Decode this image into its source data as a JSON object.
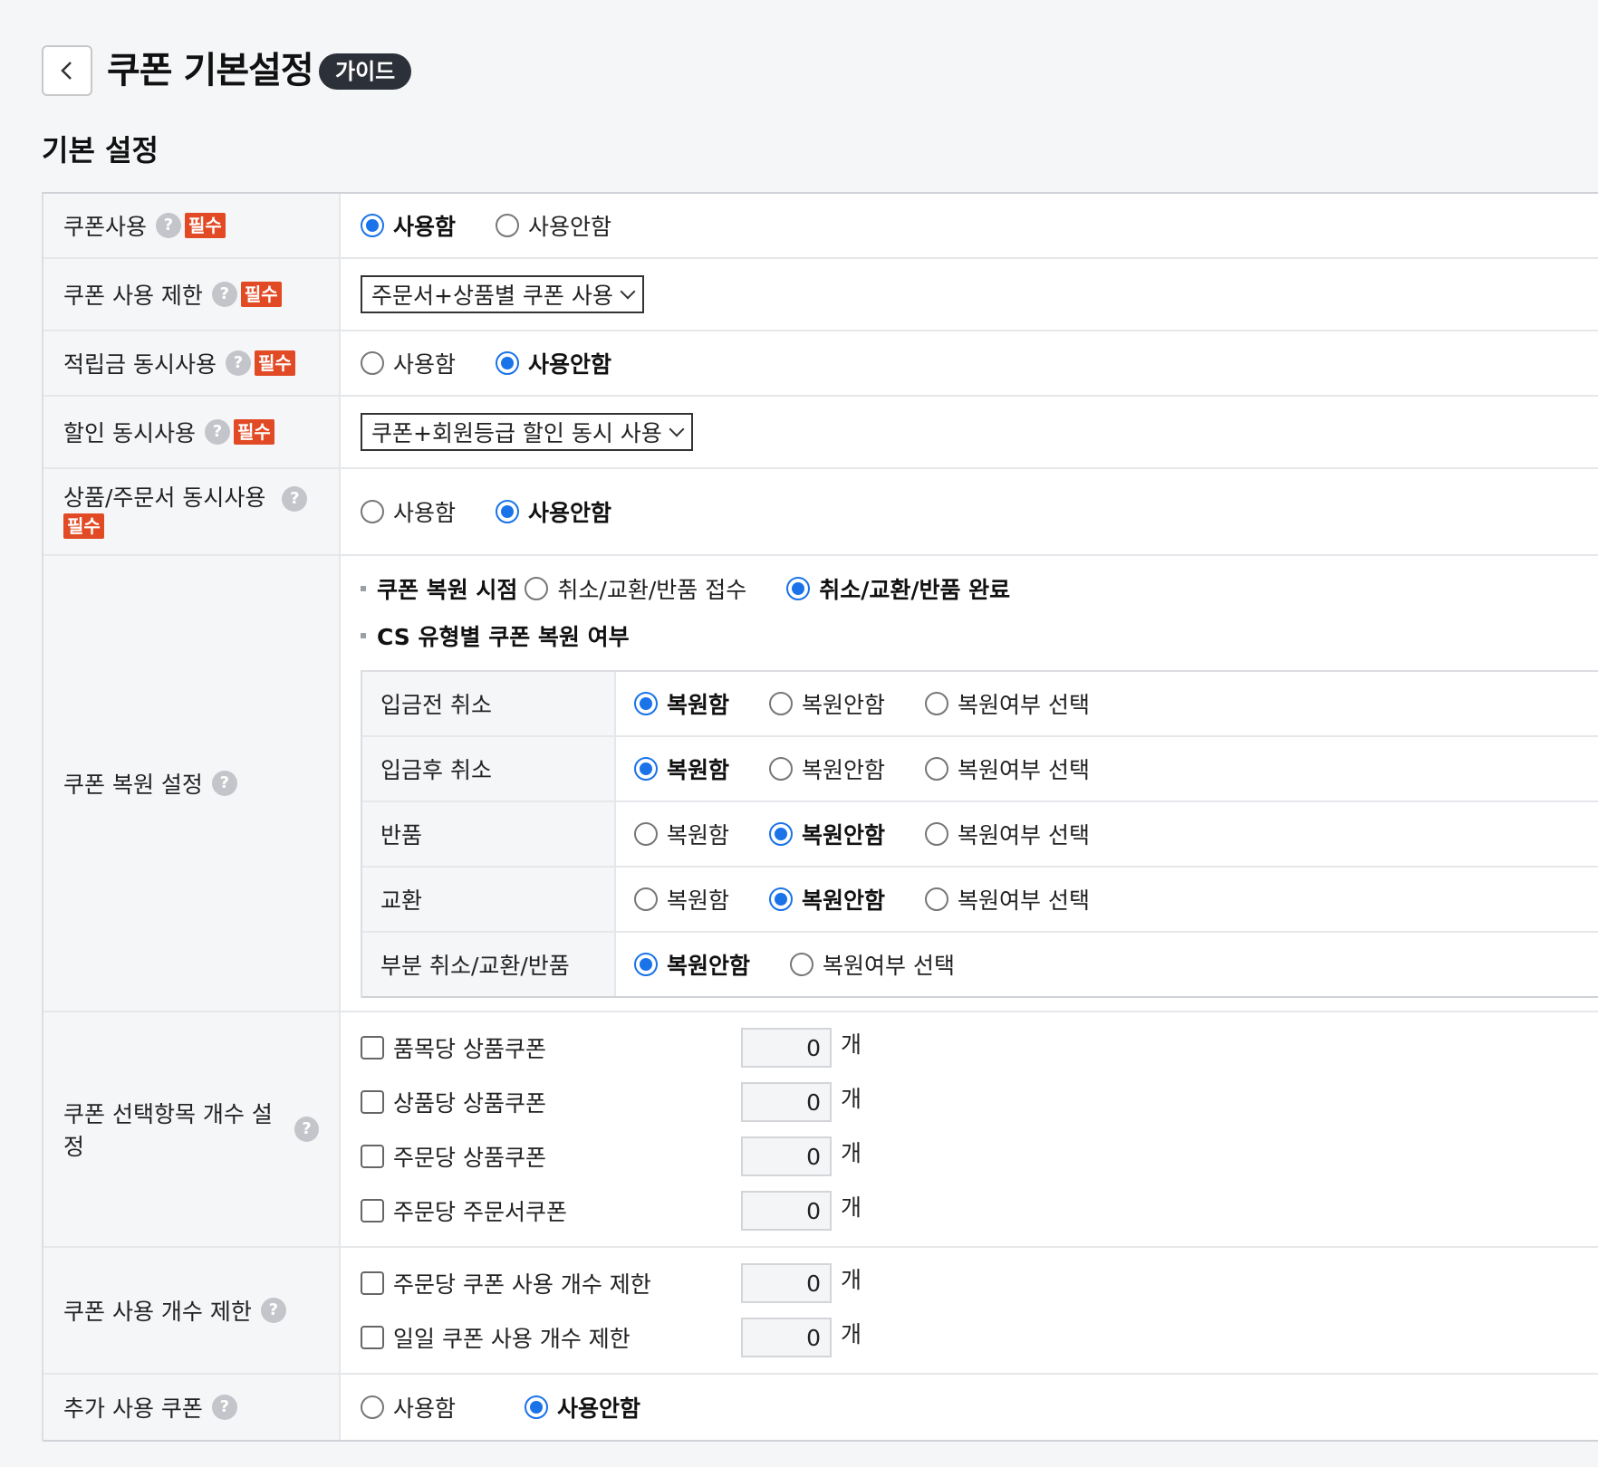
{
  "header": {
    "title": "쿠폰 기본설정",
    "guide_label": "가이드"
  },
  "section_title": "기본 설정",
  "badges": {
    "help": "?",
    "required": "필수"
  },
  "rows": {
    "coupon_use": {
      "label": "쿠폰사용",
      "options": [
        "사용함",
        "사용안함"
      ],
      "selected": 0
    },
    "coupon_limit": {
      "label": "쿠폰 사용 제한",
      "select_value": "주문서+상품별 쿠폰 사용"
    },
    "points_concurrent": {
      "label": "적립금 동시사용",
      "options": [
        "사용함",
        "사용안함"
      ],
      "selected": 1
    },
    "discount_concurrent": {
      "label": "할인 동시사용",
      "select_value": "쿠폰+회원등급 할인 동시 사용"
    },
    "product_order_concurrent": {
      "label": "상품/주문서 동시사용",
      "options": [
        "사용함",
        "사용안함"
      ],
      "selected": 1
    },
    "restore": {
      "label": "쿠폰 복원 설정",
      "timing_label": "쿠폰 복원 시점",
      "timing_options": [
        "취소/교환/반품 접수",
        "취소/교환/반품 완료"
      ],
      "timing_selected": 1,
      "cs_label": "CS 유형별 쿠폰 복원 여부",
      "cs_rows": [
        {
          "label": "입금전 취소",
          "options": [
            "복원함",
            "복원안함",
            "복원여부 선택"
          ],
          "selected": 0
        },
        {
          "label": "입금후 취소",
          "options": [
            "복원함",
            "복원안함",
            "복원여부 선택"
          ],
          "selected": 0
        },
        {
          "label": "반품",
          "options": [
            "복원함",
            "복원안함",
            "복원여부 선택"
          ],
          "selected": 1
        },
        {
          "label": "교환",
          "options": [
            "복원함",
            "복원안함",
            "복원여부 선택"
          ],
          "selected": 1
        },
        {
          "label": "부분 취소/교환/반품",
          "options": [
            "복원안함",
            "복원여부 선택"
          ],
          "selected": 0
        }
      ]
    },
    "select_count": {
      "label": "쿠폰 선택항목 개수 설정",
      "unit": "개",
      "items": [
        {
          "label": "품목당 상품쿠폰",
          "value": "0"
        },
        {
          "label": "상품당 상품쿠폰",
          "value": "0"
        },
        {
          "label": "주문당 상품쿠폰",
          "value": "0"
        },
        {
          "label": "주문당 주문서쿠폰",
          "value": "0"
        }
      ]
    },
    "use_count": {
      "label": "쿠폰 사용 개수 제한",
      "unit": "개",
      "items": [
        {
          "label": "주문당 쿠폰 사용 개수 제한",
          "value": "0"
        },
        {
          "label": "일일 쿠폰 사용 개수 제한",
          "value": "0"
        }
      ]
    },
    "extra_coupon": {
      "label": "추가 사용 쿠폰",
      "options": [
        "사용함",
        "사용안함"
      ],
      "selected": 1
    }
  },
  "colors": {
    "accent": "#1a73e8",
    "required": "#e14a24",
    "badge_dark": "#2c3038"
  }
}
